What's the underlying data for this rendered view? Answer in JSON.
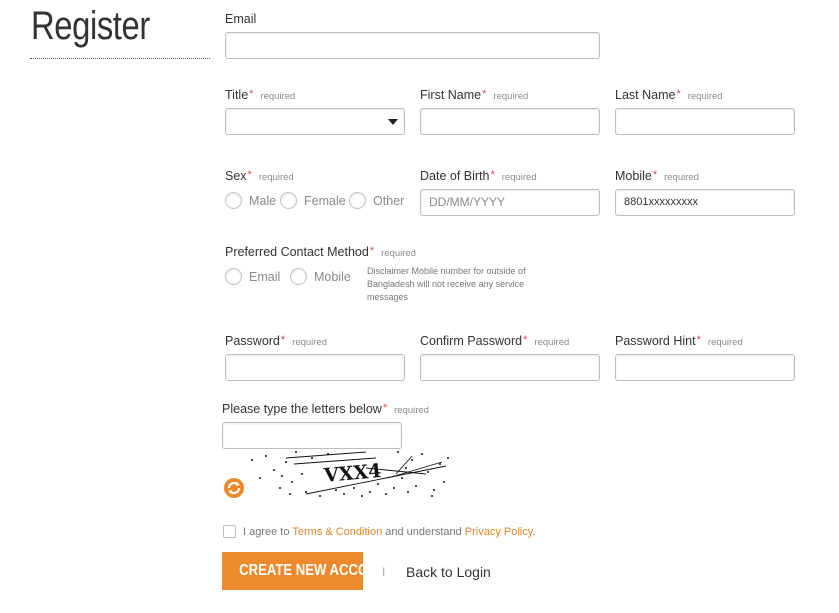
{
  "page": {
    "title": "Register"
  },
  "form": {
    "required_text": "required",
    "email": {
      "label": "Email",
      "value": ""
    },
    "title": {
      "label": "Title",
      "value": ""
    },
    "first_name": {
      "label": "First Name",
      "value": ""
    },
    "last_name": {
      "label": "Last Name",
      "value": ""
    },
    "sex": {
      "label": "Sex",
      "options": [
        "Male",
        "Female",
        "Other"
      ]
    },
    "dob": {
      "label": "Date of Birth",
      "placeholder": "DD/MM/YYYY"
    },
    "mobile": {
      "label": "Mobile",
      "value": "8801xxxxxxxxx"
    },
    "contact_method": {
      "label": "Preferred Contact Method",
      "options": [
        "Email",
        "Mobile"
      ],
      "disclaimer": "Disclaimer Mobile number for outside of Bangladesh will not receive any service messages"
    },
    "password": {
      "label": "Password"
    },
    "confirm_password": {
      "label": "Confirm Password"
    },
    "password_hint": {
      "label": "Password Hint"
    },
    "captcha": {
      "label": "Please type the letters below",
      "text": "VXX4"
    },
    "agreement": {
      "prefix": "I agree to ",
      "terms_link": "Terms & Condition",
      "middle": " and understand ",
      "privacy_link": "Privacy Policy",
      "suffix": "."
    },
    "submit_label": "CREATE NEW ACCOUNT",
    "separator": "I",
    "back_label": "Back to Login"
  },
  "colors": {
    "accent": "#ee8a2c",
    "link": "#e2832d",
    "required_star": "#e8494b"
  }
}
